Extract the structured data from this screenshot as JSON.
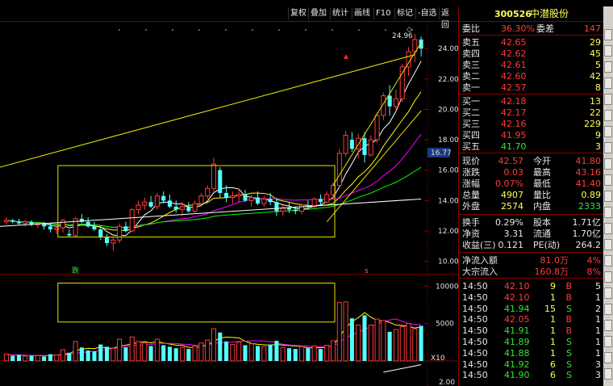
{
  "toolbar": {
    "buttons": [
      "复权",
      "叠加",
      "统计",
      "画线",
      "F10",
      "标记",
      "-自选",
      "返回"
    ]
  },
  "chart": {
    "price_ticks": [
      "24.00",
      "22.00",
      "20.00",
      "18.00",
      "16.00",
      "14.00",
      "12.00",
      "10.00"
    ],
    "high_label": "24.96",
    "crosshair_price": "16.77",
    "label_die": "跌",
    "label_s": "s",
    "volume_ticks": [
      "10000",
      "5000"
    ],
    "volume_unit": "X10",
    "macd_tick": "2.00"
  },
  "quote": {
    "code": "300526",
    "name": "中潜股份",
    "weibi_label": "委比",
    "weibi_value": "36.30%",
    "weicha_label": "委差",
    "weicha_value": "147",
    "asks": [
      {
        "label": "卖五",
        "price": "42.65",
        "vol": "29"
      },
      {
        "label": "卖四",
        "price": "42.62",
        "vol": "45"
      },
      {
        "label": "卖三",
        "price": "42.61",
        "vol": "5"
      },
      {
        "label": "卖二",
        "price": "42.60",
        "vol": "42"
      },
      {
        "label": "卖一",
        "price": "42.57",
        "vol": "8"
      }
    ],
    "bids": [
      {
        "label": "买一",
        "price": "42.18",
        "vol": "13"
      },
      {
        "label": "买二",
        "price": "42.17",
        "vol": "22"
      },
      {
        "label": "买三",
        "price": "42.16",
        "vol": "229"
      },
      {
        "label": "买四",
        "price": "41.95",
        "vol": "9"
      },
      {
        "label": "买五",
        "price": "41.70",
        "vol": "3"
      }
    ],
    "stats": [
      {
        "l1": "现价",
        "v1": "42.57",
        "l2": "今开",
        "v2": "41.80"
      },
      {
        "l1": "涨跌",
        "v1": "0.03",
        "l2": "最高",
        "v2": "43.16"
      },
      {
        "l1": "涨幅",
        "v1": "0.07%",
        "l2": "最低",
        "v2": "41.40"
      },
      {
        "l1": "总量",
        "v1": "4907",
        "l2": "量比",
        "v2": "0.89"
      },
      {
        "l1": "外盘",
        "v1": "2574",
        "l2": "内盘",
        "v2": "2333"
      }
    ],
    "fundamentals": [
      {
        "l1": "换手",
        "v1": "0.29%",
        "l2": "股本",
        "v2": "1.71亿"
      },
      {
        "l1": "净资",
        "v1": "3.31",
        "l2": "流通",
        "v2": "1.70亿"
      },
      {
        "l1": "收益(三)",
        "v1": "0.121",
        "l2": "PE(动)",
        "v2": "264.2"
      }
    ],
    "flows": [
      {
        "label": "净流入额",
        "value": "81.0万",
        "pct": "4%"
      },
      {
        "label": "大宗流入",
        "value": "160.8万",
        "pct": "8%"
      }
    ],
    "ticks": [
      {
        "time": "14:50",
        "price": "42.10",
        "vol": "9",
        "side": "B",
        "n": "5"
      },
      {
        "time": "14:50",
        "price": "42.10",
        "vol": "1",
        "side": "B",
        "n": "1"
      },
      {
        "time": "14:50",
        "price": "41.94",
        "vol": "15",
        "side": "S",
        "n": "2"
      },
      {
        "time": "14:50",
        "price": "42.05",
        "vol": "1",
        "side": "B",
        "n": "1"
      },
      {
        "time": "14:50",
        "price": "41.91",
        "vol": "1",
        "side": "B",
        "n": "1"
      },
      {
        "time": "14:50",
        "price": "41.89",
        "vol": "1",
        "side": "S",
        "n": "1"
      },
      {
        "time": "14:50",
        "price": "41.88",
        "vol": "1",
        "side": "S",
        "n": "1"
      },
      {
        "time": "14:50",
        "price": "41.92",
        "vol": "6",
        "side": "S",
        "n": "3"
      },
      {
        "time": "14:50",
        "price": "41.90",
        "vol": "6",
        "side": "S",
        "n": "3"
      }
    ]
  },
  "colors": {
    "up": "#ff3b3b",
    "down": "#54ffff",
    "border": "#8b0000",
    "box": "#e6e600",
    "ma5": "#ffffff",
    "ma10": "#ffff00",
    "ma20": "#ff00ff",
    "ma60": "#00ff00"
  },
  "chart_data": {
    "type": "candlestick",
    "ylim": [
      9.5,
      25.5
    ],
    "candles": [
      [
        12.6,
        12.9,
        12.4,
        12.7
      ],
      [
        12.7,
        12.8,
        12.5,
        12.6
      ],
      [
        12.6,
        12.8,
        12.4,
        12.5
      ],
      [
        12.5,
        12.7,
        12.3,
        12.6
      ],
      [
        12.6,
        12.7,
        12.3,
        12.4
      ],
      [
        12.4,
        12.6,
        12.2,
        12.5
      ],
      [
        12.5,
        12.6,
        12.1,
        12.3
      ],
      [
        12.3,
        12.5,
        11.9,
        12.1
      ],
      [
        12.1,
        12.4,
        11.8,
        12.2
      ],
      [
        12.2,
        12.8,
        11.9,
        12.7
      ],
      [
        11.8,
        12.1,
        11.6,
        11.7
      ],
      [
        11.7,
        12.9,
        11.6,
        12.8
      ],
      [
        12.8,
        13.1,
        12.5,
        12.6
      ],
      [
        12.6,
        12.9,
        12.2,
        12.3
      ],
      [
        12.3,
        12.6,
        12.0,
        12.1
      ],
      [
        12.1,
        12.3,
        11.4,
        11.6
      ],
      [
        11.6,
        11.8,
        11.0,
        11.2
      ],
      [
        11.2,
        11.6,
        10.7,
        11.4
      ],
      [
        11.4,
        12.5,
        11.2,
        12.3
      ],
      [
        12.3,
        12.6,
        11.9,
        12.0
      ],
      [
        12.0,
        13.5,
        11.9,
        13.4
      ],
      [
        13.4,
        14.0,
        13.1,
        13.7
      ],
      [
        13.7,
        14.2,
        13.4,
        13.9
      ],
      [
        13.9,
        14.3,
        13.5,
        13.6
      ],
      [
        13.6,
        14.5,
        13.4,
        14.3
      ],
      [
        14.3,
        14.6,
        13.8,
        14.0
      ],
      [
        14.0,
        14.4,
        13.5,
        13.6
      ],
      [
        13.6,
        14.0,
        13.2,
        13.4
      ],
      [
        13.4,
        13.9,
        13.0,
        13.6
      ],
      [
        13.6,
        13.9,
        13.2,
        13.3
      ],
      [
        13.3,
        14.0,
        13.2,
        13.8
      ],
      [
        13.8,
        14.5,
        13.6,
        14.3
      ],
      [
        14.3,
        15.0,
        14.1,
        14.8
      ],
      [
        14.8,
        16.8,
        14.6,
        16.4
      ],
      [
        16.0,
        16.2,
        14.2,
        14.5
      ],
      [
        14.5,
        15.0,
        13.9,
        14.2
      ],
      [
        14.2,
        14.6,
        13.8,
        14.3
      ],
      [
        14.3,
        14.8,
        13.9,
        14.4
      ],
      [
        14.4,
        14.7,
        13.9,
        14.0
      ],
      [
        14.0,
        14.4,
        13.6,
        14.2
      ],
      [
        14.2,
        14.6,
        13.7,
        13.8
      ],
      [
        13.8,
        14.3,
        13.6,
        14.1
      ],
      [
        14.1,
        14.5,
        13.7,
        13.9
      ],
      [
        13.9,
        14.2,
        13.0,
        13.3
      ],
      [
        13.3,
        13.7,
        13.0,
        13.5
      ],
      [
        13.5,
        13.9,
        13.2,
        13.4
      ],
      [
        13.4,
        13.6,
        13.1,
        13.3
      ],
      [
        13.3,
        13.8,
        13.1,
        13.7
      ],
      [
        13.7,
        14.0,
        13.4,
        13.6
      ],
      [
        13.6,
        14.2,
        13.5,
        14.1
      ],
      [
        14.1,
        14.4,
        13.7,
        13.9
      ],
      [
        13.9,
        14.6,
        13.8,
        14.4
      ],
      [
        14.4,
        15.2,
        14.2,
        15.0
      ],
      [
        15.0,
        17.4,
        14.8,
        17.1
      ],
      [
        17.1,
        18.6,
        16.9,
        18.3
      ],
      [
        18.0,
        18.5,
        17.2,
        17.4
      ],
      [
        17.4,
        18.4,
        16.8,
        18.1
      ],
      [
        18.1,
        18.5,
        16.5,
        17.0
      ],
      [
        17.0,
        18.3,
        16.9,
        18.0
      ],
      [
        18.0,
        19.8,
        17.8,
        19.6
      ],
      [
        19.6,
        21.1,
        19.3,
        20.9
      ],
      [
        20.9,
        21.6,
        19.6,
        20.2
      ],
      [
        20.2,
        21.3,
        19.9,
        20.7
      ],
      [
        20.7,
        23.0,
        20.5,
        22.8
      ],
      [
        22.8,
        24.1,
        22.2,
        23.8
      ],
      [
        23.8,
        24.96,
        23.1,
        24.6
      ],
      [
        24.6,
        24.8,
        23.5,
        24.0
      ]
    ],
    "volumes": [
      900,
      700,
      800,
      650,
      700,
      720,
      600,
      900,
      800,
      1500,
      1100,
      2600,
      1800,
      1400,
      1300,
      2200,
      1900,
      1700,
      2900,
      1800,
      3200,
      2600,
      2400,
      2000,
      2900,
      2100,
      1900,
      1700,
      1800,
      1600,
      2000,
      2400,
      2800,
      4300,
      3800,
      2600,
      2200,
      2500,
      2100,
      2300,
      2000,
      1900,
      2200,
      2700,
      1800,
      1700,
      1600,
      1900,
      1700,
      2000,
      1600,
      2100,
      2700,
      7800,
      7900,
      5700,
      4800,
      6100,
      4800,
      5600,
      5400,
      3900,
      4200,
      4600,
      5000,
      4300,
      4700
    ],
    "volume_ylim": [
      0,
      11000
    ]
  }
}
